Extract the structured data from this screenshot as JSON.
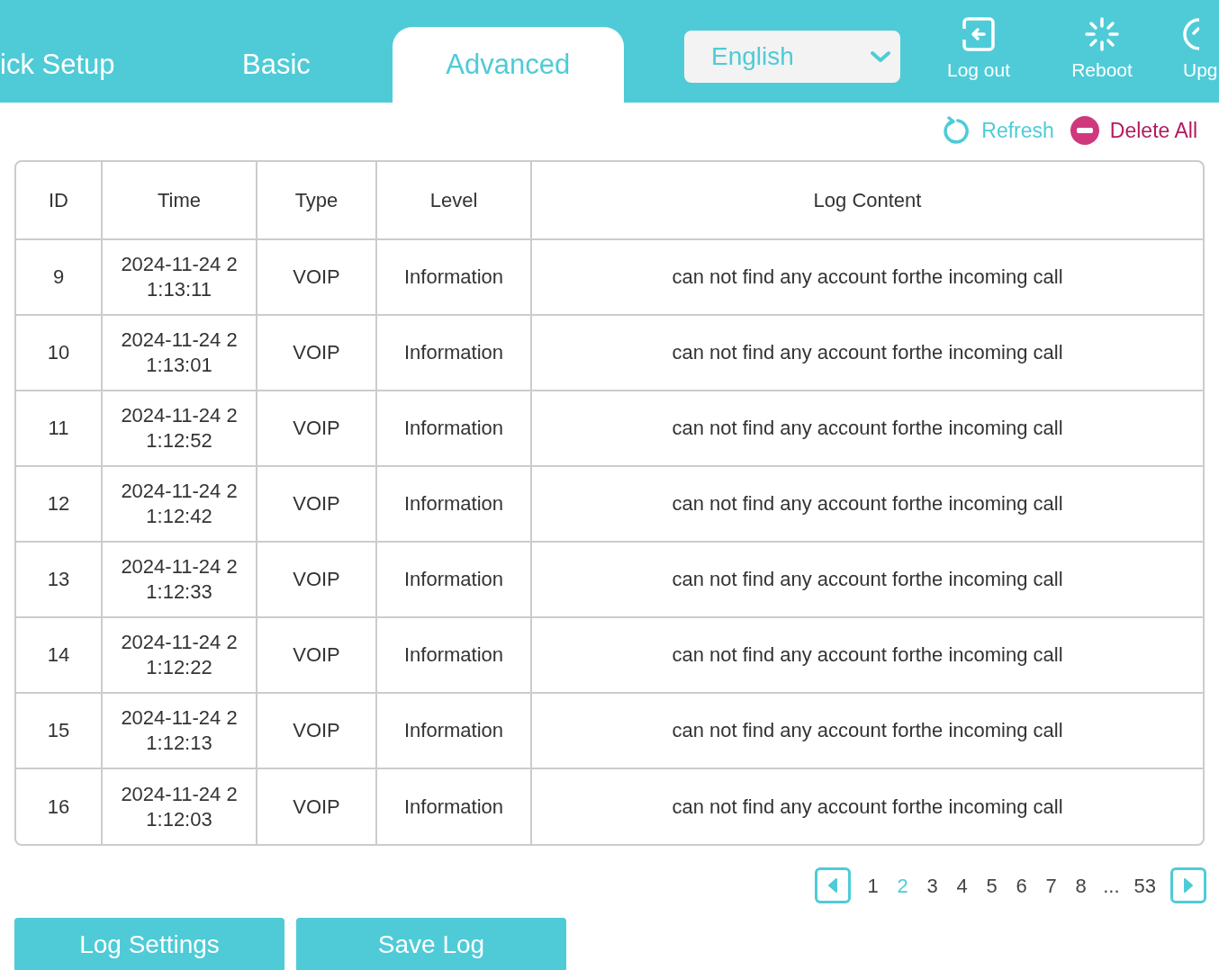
{
  "tabs": [
    {
      "label": "ick Setup",
      "selected": false
    },
    {
      "label": "Basic",
      "selected": false
    },
    {
      "label": "Advanced",
      "selected": true
    }
  ],
  "language": {
    "value": "English"
  },
  "header_actions": [
    {
      "kind": "logout",
      "label": "Log out"
    },
    {
      "kind": "reboot",
      "label": "Reboot"
    },
    {
      "kind": "upgrade",
      "label": "Upg"
    }
  ],
  "toolbar": [
    {
      "kind": "refresh",
      "label": "Refresh"
    },
    {
      "kind": "delete",
      "label": "Delete All"
    }
  ],
  "table": {
    "columns": [
      "ID",
      "Time",
      "Type",
      "Level",
      "Log Content"
    ],
    "rows": [
      [
        "9",
        "2024-11-24 21:13:11",
        "VOIP",
        "Information",
        "can not find any account forthe incoming call"
      ],
      [
        "10",
        "2024-11-24 21:13:01",
        "VOIP",
        "Information",
        "can not find any account forthe incoming call"
      ],
      [
        "11",
        "2024-11-24 21:12:52",
        "VOIP",
        "Information",
        "can not find any account forthe incoming call"
      ],
      [
        "12",
        "2024-11-24 21:12:42",
        "VOIP",
        "Information",
        "can not find any account forthe incoming call"
      ],
      [
        "13",
        "2024-11-24 21:12:33",
        "VOIP",
        "Information",
        "can not find any account forthe incoming call"
      ],
      [
        "14",
        "2024-11-24 21:12:22",
        "VOIP",
        "Information",
        "can not find any account forthe incoming call"
      ],
      [
        "15",
        "2024-11-24 21:12:13",
        "VOIP",
        "Information",
        "can not find any account forthe incoming call"
      ],
      [
        "16",
        "2024-11-24 21:12:03",
        "VOIP",
        "Information",
        "can not find any account forthe incoming call"
      ]
    ]
  },
  "pagination": {
    "pages": [
      {
        "label": "1",
        "selected": false
      },
      {
        "label": "2",
        "selected": true
      },
      {
        "label": "3",
        "selected": false
      },
      {
        "label": "4",
        "selected": false
      },
      {
        "label": "5",
        "selected": false
      },
      {
        "label": "6",
        "selected": false
      },
      {
        "label": "7",
        "selected": false
      },
      {
        "label": "8",
        "selected": false
      },
      {
        "label": "...",
        "selected": false
      },
      {
        "label": "53",
        "selected": false
      }
    ]
  },
  "buttons": [
    "Log Settings",
    "Save Log"
  ]
}
